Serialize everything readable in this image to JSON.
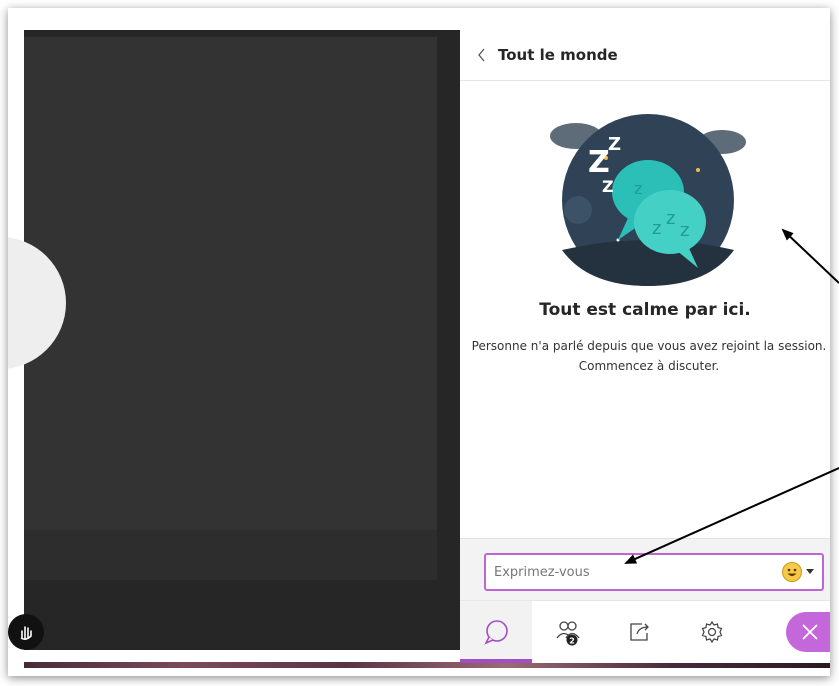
{
  "panel": {
    "title": "Tout le monde"
  },
  "empty_state": {
    "title": "Tout est calme par ici.",
    "line1": "Personne n'a parlé depuis que vous avez rejoint la session.",
    "line2": "Commencez à discuter."
  },
  "composer": {
    "placeholder": "Exprimez-vous"
  },
  "tabs": [
    {
      "name": "chat",
      "icon": "chat-bubble-icon",
      "active": true
    },
    {
      "name": "participants",
      "icon": "people-icon",
      "badge": "2"
    },
    {
      "name": "share",
      "icon": "share-icon"
    },
    {
      "name": "settings",
      "icon": "gear-icon"
    }
  ],
  "colors": {
    "accent": "#a34fc4",
    "close_button": "#c467da",
    "composer_border": "#c065d4",
    "stage": "#333333"
  }
}
